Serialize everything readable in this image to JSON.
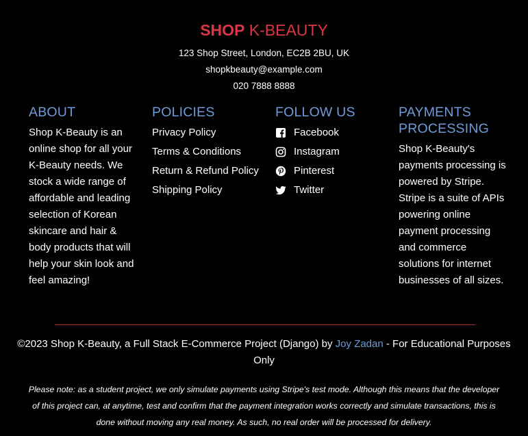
{
  "brand": {
    "shop": "SHOP",
    "kbeauty": " K-BEAUTY"
  },
  "contact": {
    "address": "123 Shop Street, London, EC2B 2BU, UK",
    "email": "shopkbeauty@example.com",
    "phone": "020 7888 8888"
  },
  "about": {
    "heading": "ABOUT",
    "text": "Shop K-Beauty is an online shop for all your K-Beauty needs. We stock a wide range of affordable and leading selection of Korean skincare and hair & body products that will help your skin look and feel amazing!"
  },
  "policies": {
    "heading": "POLICIES",
    "items": [
      {
        "label": "Privacy Policy"
      },
      {
        "label": "Terms & Conditions"
      },
      {
        "label": "Return & Refund Policy"
      },
      {
        "label": "Shipping Policy"
      }
    ]
  },
  "follow": {
    "heading": "FOLLOW US",
    "items": [
      {
        "label": "Facebook",
        "icon": "facebook-icon"
      },
      {
        "label": "Instagram",
        "icon": "instagram-icon"
      },
      {
        "label": "Pinterest",
        "icon": "pinterest-icon"
      },
      {
        "label": "Twitter",
        "icon": "twitter-icon"
      }
    ]
  },
  "payments": {
    "heading": "PAYMENTS PROCESSING",
    "text": "Shop K-Beauty's payments processing is powered by Stripe. Stripe is a suite of APIs powering online payment processing and commerce solutions for internet businesses of all sizes."
  },
  "footer": {
    "copyright_prefix": "©2023 Shop K-Beauty, a Full Stack E-Commerce Project (Django) by ",
    "author": "Joy Zadan",
    "copyright_suffix": " - For Educational Purposes Only",
    "note": "Please note: as a student project, we only simulate payments using Stripe's test mode. Although this means that the developer of this project can, at anytime, test and confirm that the payment integration works correctly and simulate transactions, this is done without moving any real money. As such, no real order will be processed for delivery."
  },
  "colors": {
    "brand_red": "#dc3545",
    "heading_blue": "#6f9bd8",
    "background": "#000000"
  }
}
